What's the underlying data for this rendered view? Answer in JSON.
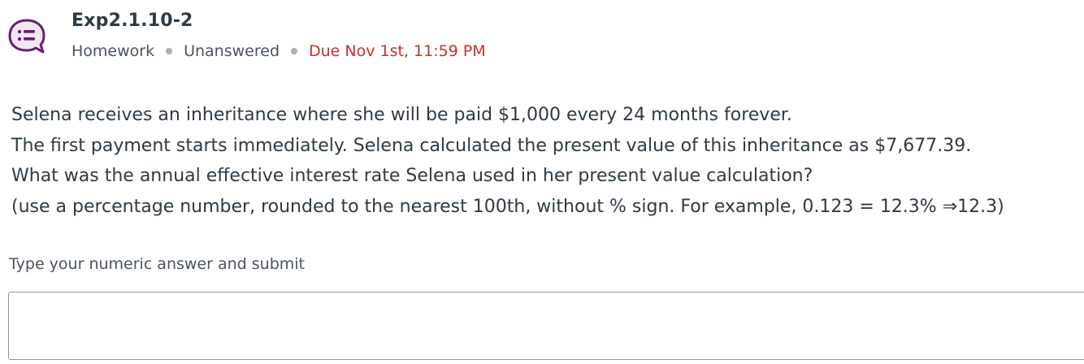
{
  "header": {
    "icon": "question-list-chat-icon",
    "icon_color": "#6b1d6d",
    "title": "Exp2.1.10-2",
    "meta": {
      "type": "Homework",
      "status": "Unanswered",
      "due": "Due Nov 1st, 11:59 PM",
      "due_color": "#c0322a"
    }
  },
  "question": {
    "lines": [
      "Selena receives an inheritance where she will be paid $1,000 every 24 months forever.",
      "The first payment starts immediately. Selena calculated the present value of this inheritance as $7,677.39.",
      "What was the annual effective interest rate Selena used in her present value calculation?",
      "(use a percentage  number, rounded to the nearest 100th, without % sign. For example,  0.123  = 12.3%  ⇒12.3)"
    ]
  },
  "answer": {
    "prompt": "Type your numeric answer and submit",
    "value": "",
    "placeholder": ""
  }
}
